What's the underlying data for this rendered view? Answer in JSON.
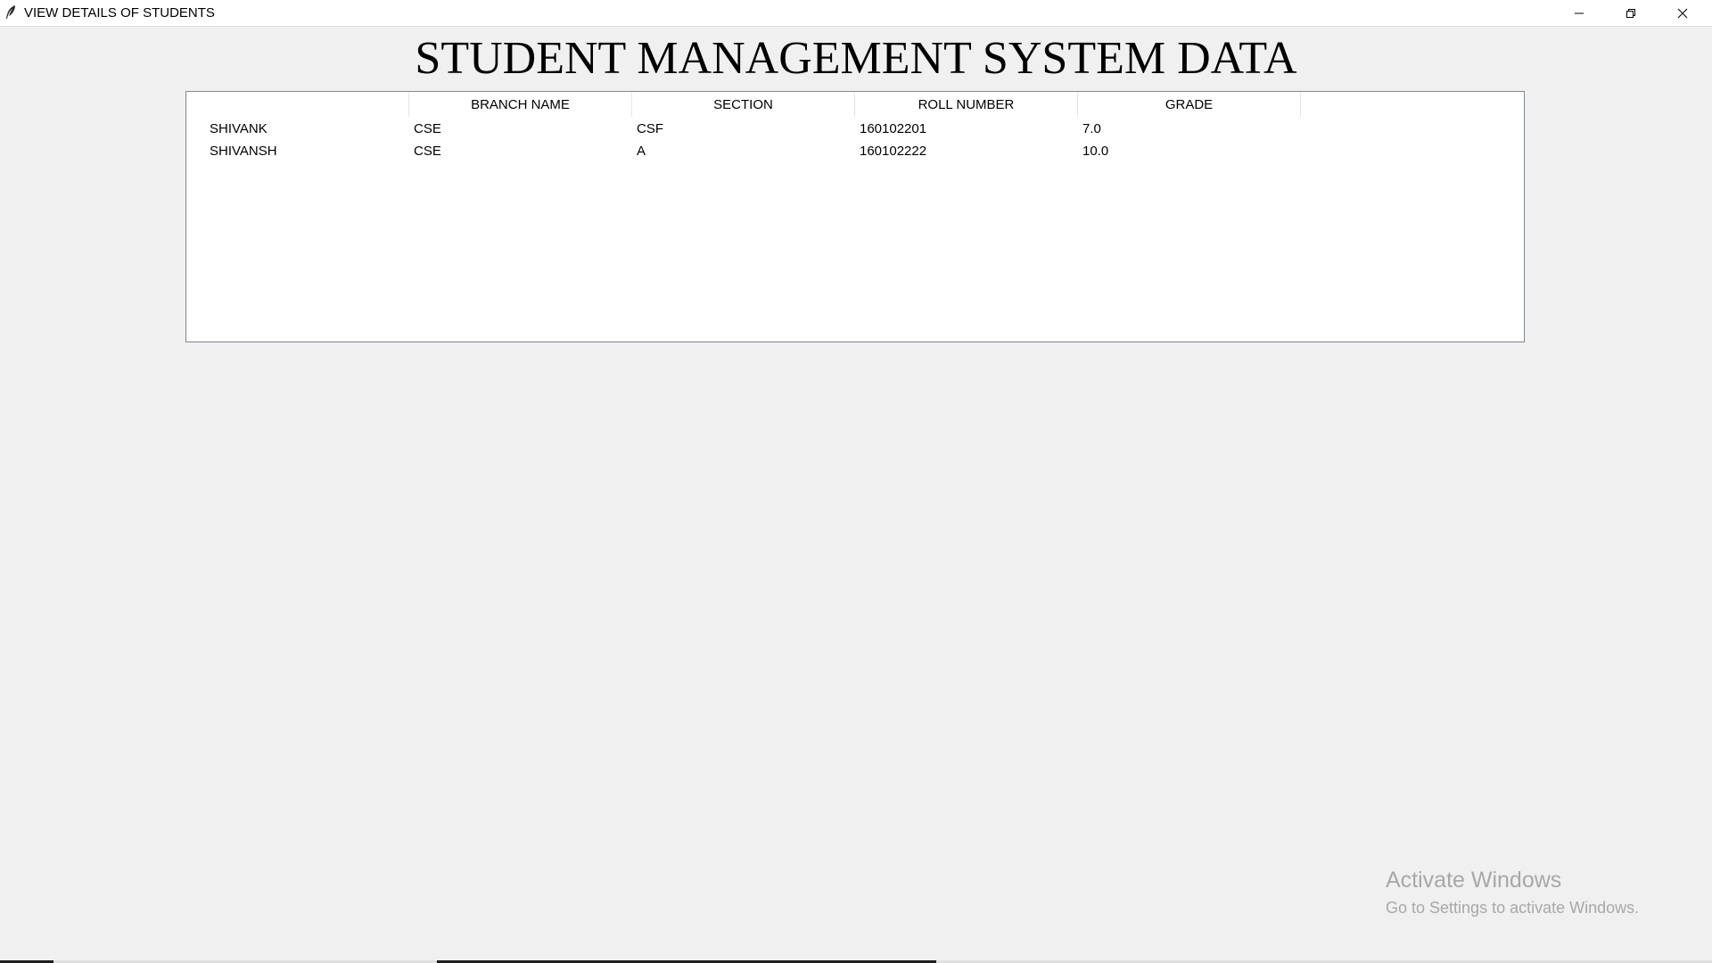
{
  "window": {
    "title": "VIEW DETAILS OF STUDENTS"
  },
  "heading": "STUDENT MANAGEMENT SYSTEM DATA",
  "table": {
    "columns": [
      "",
      "BRANCH NAME",
      "SECTION",
      "ROLL NUMBER",
      "GRADE"
    ],
    "rows": [
      [
        "SHIVANK",
        "CSE",
        "CSF",
        "160102201",
        "7.0"
      ],
      [
        "SHIVANSH",
        "CSE",
        "A",
        "160102222",
        "10.0"
      ]
    ]
  },
  "watermark": {
    "title": "Activate Windows",
    "subtitle": "Go to Settings to activate Windows."
  }
}
